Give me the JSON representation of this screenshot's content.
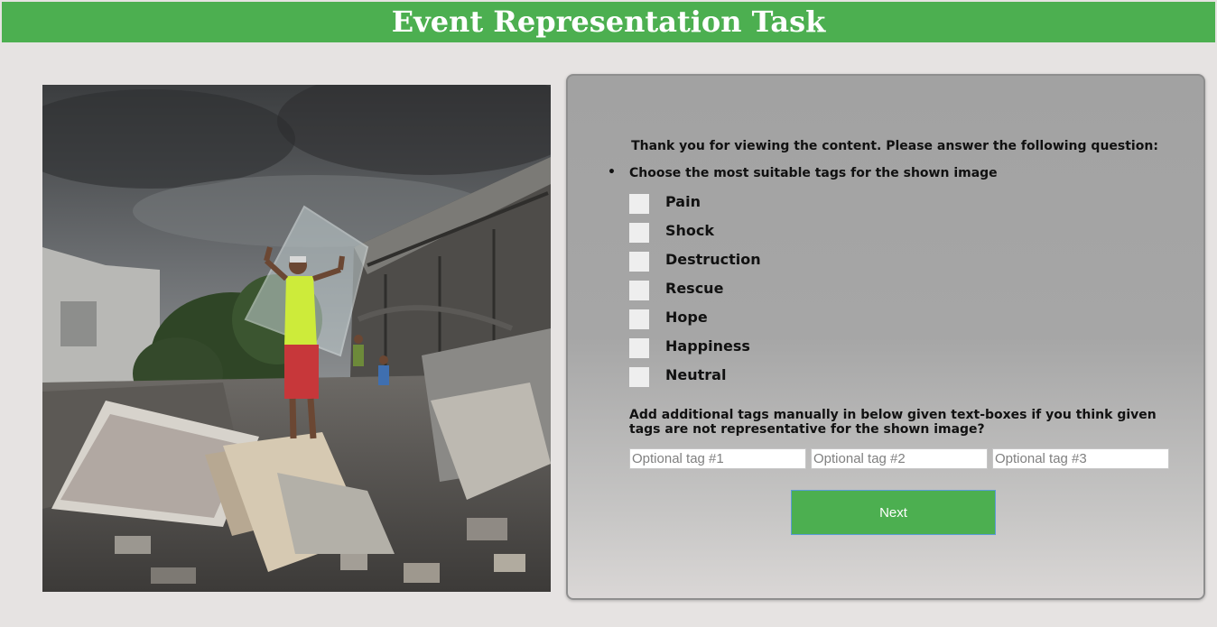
{
  "header": {
    "title": "Event Representation Task"
  },
  "image": {
    "subject": "man carrying glass pane through earthquake rubble under stormy sky"
  },
  "panel": {
    "thanks_text": "Thank you for viewing the content. Please answer the following question:",
    "question": "Choose the most suitable tags for the shown image",
    "tags": [
      {
        "label": "Pain",
        "checked": false
      },
      {
        "label": "Shock",
        "checked": false
      },
      {
        "label": "Destruction",
        "checked": false
      },
      {
        "label": "Rescue",
        "checked": false
      },
      {
        "label": "Hope",
        "checked": false
      },
      {
        "label": "Happiness",
        "checked": false
      },
      {
        "label": "Neutral",
        "checked": false
      }
    ],
    "manual_text": "Add additional tags manually in below given text-boxes if you think given tags are not representative for the shown image?",
    "optional_tags": [
      {
        "placeholder": "Optional tag #1",
        "value": ""
      },
      {
        "placeholder": "Optional tag #2",
        "value": ""
      },
      {
        "placeholder": "Optional tag #3",
        "value": ""
      }
    ],
    "next_label": "Next"
  },
  "colors": {
    "header_bg": "#4caf50",
    "button_bg": "#4caf50",
    "page_bg": "#e6e3e2"
  }
}
